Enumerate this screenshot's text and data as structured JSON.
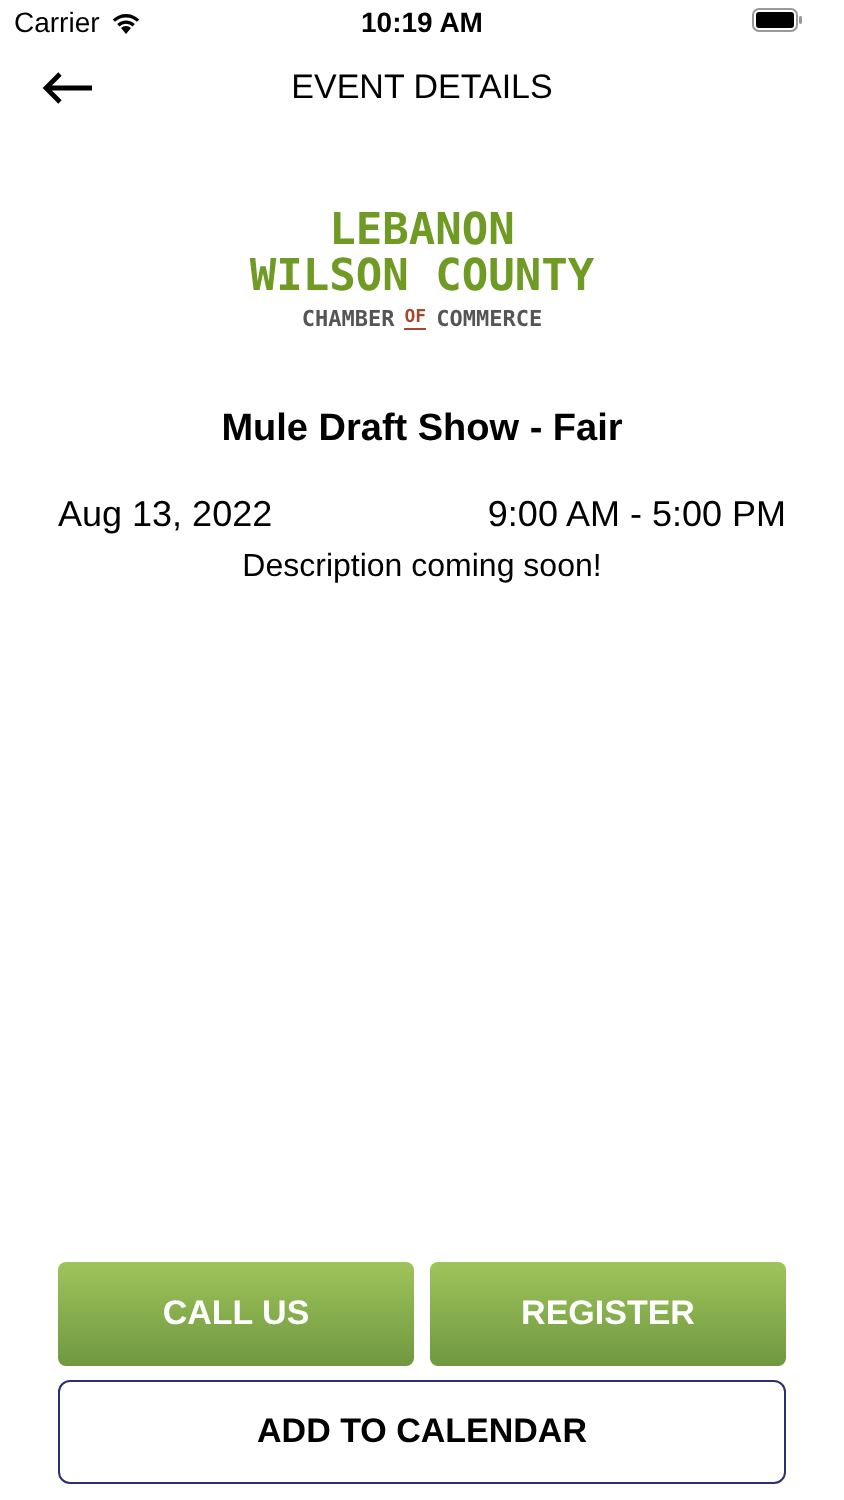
{
  "status_bar": {
    "carrier": "Carrier",
    "time": "10:19 AM"
  },
  "header": {
    "title": "EVENT DETAILS"
  },
  "logo": {
    "line_1": "LEBANON",
    "line_2": "WILSON COUNTY",
    "line_3_left": "CHAMBER",
    "line_3_middle": "OF",
    "line_3_right": "COMMERCE"
  },
  "event": {
    "title": "Mule Draft Show - Fair",
    "date": "Aug 13, 2022",
    "time": "9:00 AM - 5:00 PM",
    "description": "Description coming soon!"
  },
  "buttons": [
    {
      "label": "CALL US",
      "kind": "filled"
    },
    {
      "label": "REGISTER",
      "kind": "filled"
    },
    {
      "label": "ADD TO CALENDAR",
      "kind": "outline"
    }
  ]
}
